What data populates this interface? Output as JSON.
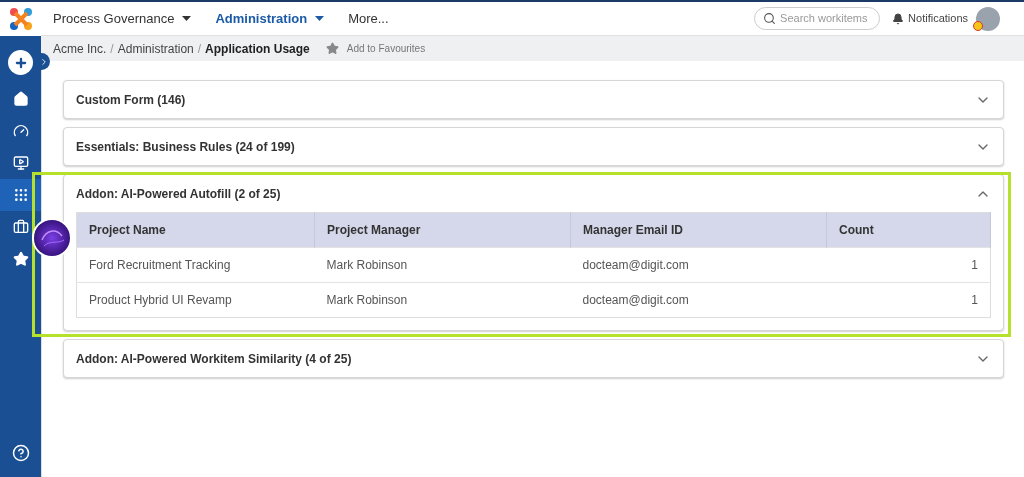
{
  "top_nav": {
    "menus": [
      {
        "label": "Process Governance",
        "selected": false,
        "dropdown": true
      },
      {
        "label": "Administration",
        "selected": true,
        "dropdown": true
      },
      {
        "label": "More...",
        "selected": false,
        "dropdown": false
      }
    ],
    "search": {
      "placeholder": "Search workitems"
    },
    "notifications": "Notifications"
  },
  "sidebar": {
    "items": [
      {
        "kind": "home",
        "selected": false
      },
      {
        "kind": "dashboard",
        "selected": false
      },
      {
        "kind": "screen",
        "selected": false
      },
      {
        "kind": "grid",
        "selected": true
      },
      {
        "kind": "briefcase",
        "selected": false
      },
      {
        "kind": "star",
        "selected": false
      }
    ]
  },
  "breadcrumb": {
    "items": [
      "Acme Inc.",
      "Administration",
      "Application Usage"
    ],
    "separator": "/",
    "favourite": "Add to Favourites"
  },
  "sections": [
    {
      "title": "Custom Form (146)",
      "expanded": false,
      "highlighted": false
    },
    {
      "title": "Essentials: Business Rules (24 of 199)",
      "expanded": false,
      "highlighted": false
    },
    {
      "title": "Addon: AI-Powered Autofill (2 of 25)",
      "expanded": true,
      "highlighted": true,
      "table": {
        "columns": [
          "Project Name",
          "Project Manager",
          "Manager Email ID",
          "Count"
        ],
        "rows": [
          [
            "Ford Recruitment Tracking",
            "Mark Robinson",
            "docteam@digit.com",
            "1"
          ],
          [
            "Product Hybrid UI Revamp",
            "Mark Robinson",
            "docteam@digit.com",
            "1"
          ]
        ]
      }
    },
    {
      "title": "Addon: AI-Powered Workitem Similarity (4 of 25)",
      "expanded": false,
      "highlighted": false
    }
  ]
}
